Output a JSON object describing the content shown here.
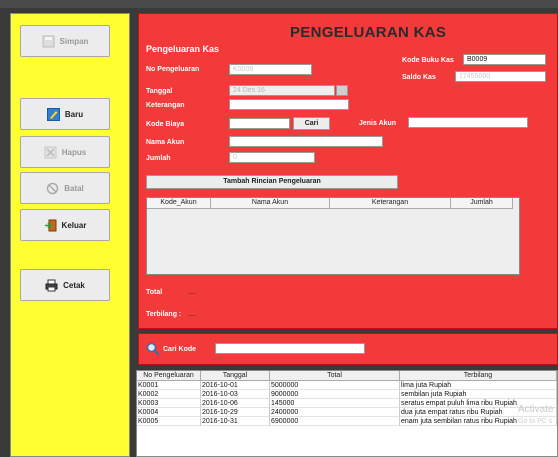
{
  "app": {
    "title": "PENGELUARAN KAS",
    "section_title": "Pengeluaran Kas"
  },
  "sidebar": {
    "simpan": "Simpan",
    "baru": "Baru",
    "hapus": "Hapus",
    "batal": "Batal",
    "keluar": "Keluar",
    "cetak": "Cetak"
  },
  "form": {
    "no_pengeluaran_label": "No Pengeluaran",
    "no_pengeluaran_value": "K0006",
    "tanggal_label": "Tanggal",
    "tanggal_value": "24 Des 16",
    "keterangan_label": "Keterangan",
    "keterangan_value": "",
    "kode_biaya_label": "Kode Biaya",
    "kode_biaya_value": "",
    "cari_label": "Cari",
    "jenis_akun_label": "Jenis Akun",
    "jenis_akun_value": "",
    "nama_akun_label": "Nama Akun",
    "nama_akun_value": "",
    "jumlah_label": "Jumlah",
    "jumlah_value": "0",
    "kode_buku_kas_label": "Kode Buku Kas",
    "kode_buku_kas_value": "B0009",
    "saldo_kas_label": "Saldo Kas",
    "saldo_kas_value": "17455000",
    "tambah_label": "Tambah Rincian Pengeluaran",
    "total_label": "Total",
    "total_value": "__",
    "terbilang_label": "Terbilang :",
    "terbilang_value": "__"
  },
  "detail_table": {
    "headers": [
      "Kode_Akun",
      "Nama Akun",
      "Keterangan",
      "Jumlah"
    ]
  },
  "search": {
    "label": "Cari Kode",
    "value": ""
  },
  "list": {
    "headers": [
      "No Pengeluaran",
      "Tanggal",
      "Total",
      "Terbilang"
    ],
    "rows": [
      [
        "K0001",
        "2016-10-01",
        "5000000",
        "lima juta Rupiah"
      ],
      [
        "K0002",
        "2016-10-03",
        "9000000",
        "sembilan juta Rupiah"
      ],
      [
        "K0003",
        "2016-10-06",
        "145000",
        "seratus empat puluh lima ribu Rupiah"
      ],
      [
        "K0004",
        "2016-10-29",
        "2400000",
        "dua juta empat ratus ribu Rupiah"
      ],
      [
        "K0005",
        "2016-10-31",
        "6900000",
        "enam juta sembilan ratus ribu Rupiah"
      ]
    ]
  },
  "watermark": {
    "line1": "Activate",
    "line2": "Go to PC s"
  }
}
